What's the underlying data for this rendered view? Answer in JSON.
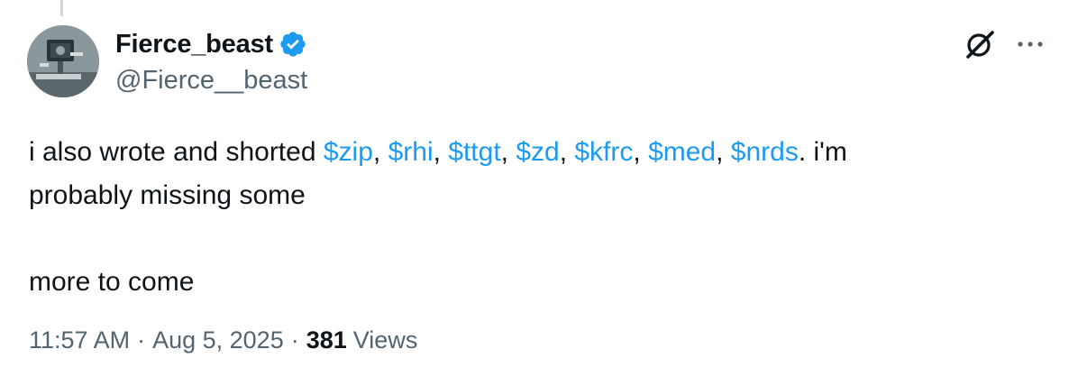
{
  "author": {
    "display_name": "Fierce_beast",
    "handle": "@Fierce__beast",
    "verified_color": "#1d9bf0"
  },
  "tweet": {
    "line1_prefix": "i also wrote and shorted ",
    "cashtags": [
      "$zip",
      "$rhi",
      "$ttgt",
      "$zd",
      "$kfrc",
      "$med",
      "$nrds"
    ],
    "separator": ", ",
    "line1_suffix": ". i'm",
    "line2": "probably missing some",
    "line3": "more to come"
  },
  "meta": {
    "time": "11:57 AM",
    "dot": "·",
    "date": "Aug 5, 2025",
    "views_count": "381",
    "views_label": "Views"
  },
  "icons": {
    "top_right": [
      "grok-icon",
      "more-icon"
    ]
  },
  "colors": {
    "link": "#1d9bf0",
    "secondary_text": "#536471",
    "primary_text": "#0f1419"
  }
}
